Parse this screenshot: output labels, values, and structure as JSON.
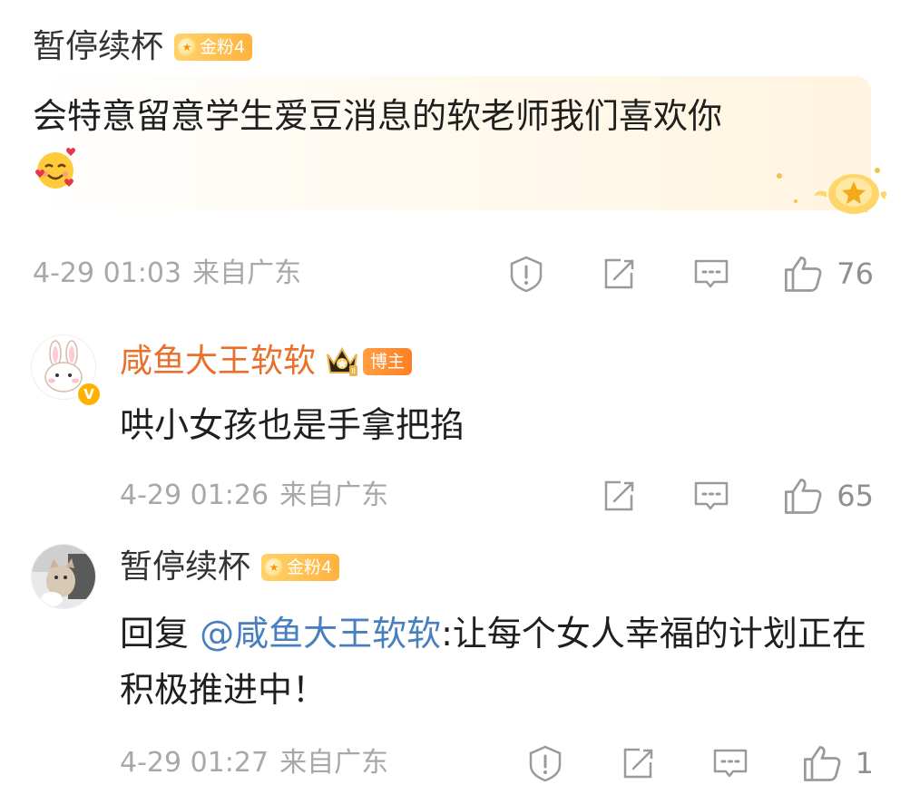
{
  "colors": {
    "accent_username": "#e8702a",
    "mention": "#4a7fbf",
    "meta_gray": "#a8a8a8",
    "badge_gold": "#ffb23e",
    "blogger_orange": "#ff7f24"
  },
  "comments": [
    {
      "username": "暂停续杯",
      "badge": "金粉4",
      "text": "会特意留意学生爱豆消息的软老师我们喜欢你",
      "emoji_icon": "smiling-face-with-hearts-icon",
      "time": "4-29 01:03",
      "location": "来自广东",
      "likes": "76"
    },
    {
      "username": "咸鱼大王软软",
      "badge": "博主",
      "text": "哄小女孩也是手拿把掐",
      "time": "4-29 01:26",
      "location": "来自广东",
      "likes": "65"
    },
    {
      "username": "暂停续杯",
      "badge": "金粉4",
      "reply_prefix": "回复 ",
      "mention": "@咸鱼大王软软",
      "text": ":让每个女人幸福的计划正在积极推进中！",
      "time": "4-29 01:27",
      "location": "来自广东",
      "likes": "1"
    }
  ]
}
